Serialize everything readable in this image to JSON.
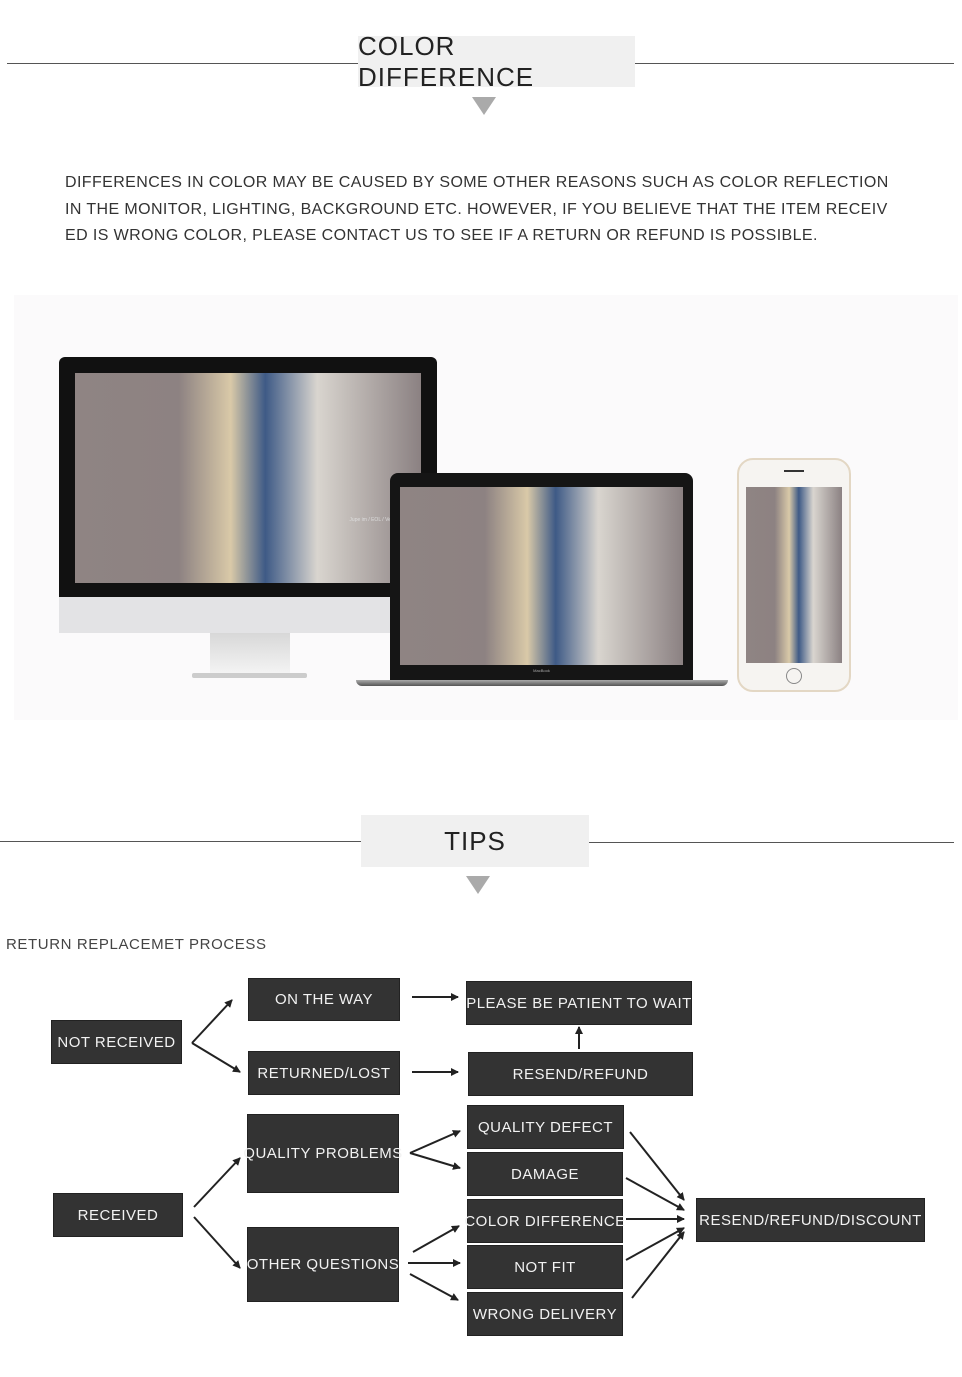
{
  "section1": {
    "title": "COLOR DIFFERENCE"
  },
  "description": "DIFFERENCES IN COLOR MAY BE CAUSED BY SOME OTHER REASONS SUCH AS COLOR REFLECTION IN THE MONITOR, LIGHTING, BACKGROUND ETC. HOWEVER, IF YOU BELIEVE THAT THE ITEM RECEIVED IS WRONG COLOR, PLEASE CONTACT US TO SEE IF A RETURN OR REFUND IS POSSIBLE.",
  "devices": {
    "monitor_caption": "Jupe im / EOL / Veste vérificat / EOL / Chem",
    "laptop_brand": "MacBook"
  },
  "section2": {
    "title": "TIPS"
  },
  "process": {
    "title": "RETURN REPLACEMET PROCESS",
    "boxes": {
      "not_received": "NOT RECEIVED",
      "on_the_way": "ON THE WAY",
      "returned_lost": "RETURNED/LOST",
      "please_wait": "PLEASE BE PATIENT TO WAIT",
      "resend_refund": "RESEND/REFUND",
      "received": "RECEIVED",
      "quality_problems": "QUALITY PROBLEMS",
      "other_questions": "OTHER QUESTIONS",
      "quality_defect": "QUALITY DEFECT",
      "damage": "DAMAGE",
      "color_difference": "COLOR DIFFERENCE",
      "not_fit": "NOT FIT",
      "wrong_delivery": "WRONG DELIVERY",
      "resend_refund_discount": "RESEND/REFUND/DISCOUNT"
    }
  },
  "colors": {
    "box": "#333333",
    "box_text": "#f2f2f2",
    "title_bg": "#f0f0f0",
    "triangle": "#aaaaaa"
  }
}
